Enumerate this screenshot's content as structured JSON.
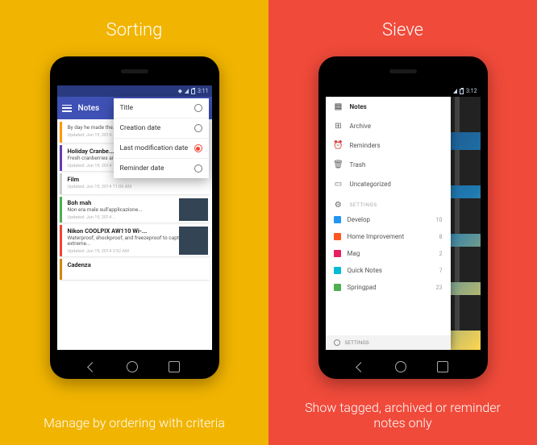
{
  "left": {
    "title": "Sorting",
    "caption": "Manage by ordering with criteria",
    "status_time": "3:11",
    "appbar_title": "Notes",
    "sort_options": [
      {
        "label": "Title",
        "selected": false
      },
      {
        "label": "Creation date",
        "selected": false
      },
      {
        "label": "Last modification date",
        "selected": true
      },
      {
        "label": "Reminder date",
        "selected": false
      }
    ],
    "notes": [
      {
        "title": "",
        "body": "By day he made the... dollars a minute. B...",
        "ts": "Updated: Jun 19, 2014 ...",
        "border": "orange"
      },
      {
        "title": "Holiday Cranbe...",
        "body": "Fresh cranberries are... spices and cooked with sugar to...",
        "ts": "Updated: Jun 19, 2014 11:07 AM",
        "border": "purple",
        "thumb": true
      },
      {
        "title": "Film",
        "body": "",
        "ts": "Updated: Jun 19, 2014 11:06 AM",
        "border": ""
      },
      {
        "title": "Boh mah",
        "body": "Non era male sull'applicazione...",
        "ts": "Updated: Jun 19, 2014 ...",
        "border": "green",
        "thumb": true
      },
      {
        "title": "Nikon COOLPIX AW110 Wi-...",
        "body": "Waterproof, shockproof, and freezeproof to capture extreme...",
        "ts": "Updated: Jun 19, 2014 2:52 AM",
        "border": "red",
        "thumb": true
      },
      {
        "title": "Cadenza",
        "body": "",
        "ts": "",
        "border": "amber"
      }
    ]
  },
  "right": {
    "title": "Sieve",
    "caption": "Show tagged, archived or reminder\nnotes only",
    "status_time": "3:12",
    "drawer": {
      "header": "Notes",
      "items": [
        {
          "icon": "archive",
          "label": "Archive"
        },
        {
          "icon": "alarm",
          "label": "Reminders"
        },
        {
          "icon": "trash",
          "label": "Trash"
        },
        {
          "icon": "folder",
          "label": "Uncategorized"
        }
      ],
      "section_label": "SETTINGS",
      "tags": [
        {
          "color": "blue",
          "label": "Develop",
          "count": "10"
        },
        {
          "color": "orange",
          "label": "Home Improvement",
          "count": "8"
        },
        {
          "color": "mag",
          "label": "Mag",
          "count": "2"
        },
        {
          "color": "cyan",
          "label": "Quick Notes",
          "count": "7"
        },
        {
          "color": "green",
          "label": "Springpad",
          "count": "23"
        }
      ],
      "footer": "SETTINGS"
    }
  }
}
